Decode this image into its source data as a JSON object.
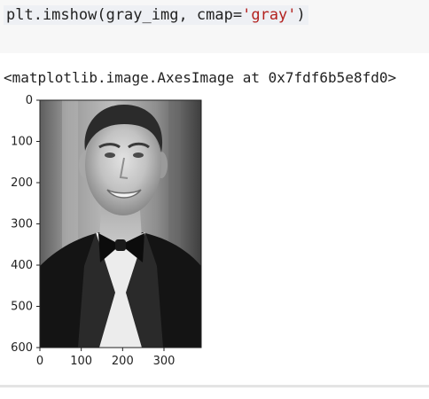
{
  "cell": {
    "code_prefix": "plt.imshow(gray_img, cmap=",
    "code_string": "'gray'",
    "code_suffix": ")"
  },
  "output": {
    "repr": "<matplotlib.image.AxesImage at 0x7fdf6b5e8fd0>"
  },
  "chart_data": {
    "type": "image",
    "cmap": "gray",
    "xlim": [
      0,
      390
    ],
    "ylim": [
      600,
      0
    ],
    "xticks": [
      "0",
      "100",
      "200",
      "300"
    ],
    "yticks": [
      "0",
      "100",
      "200",
      "300",
      "400",
      "500",
      "600"
    ]
  }
}
